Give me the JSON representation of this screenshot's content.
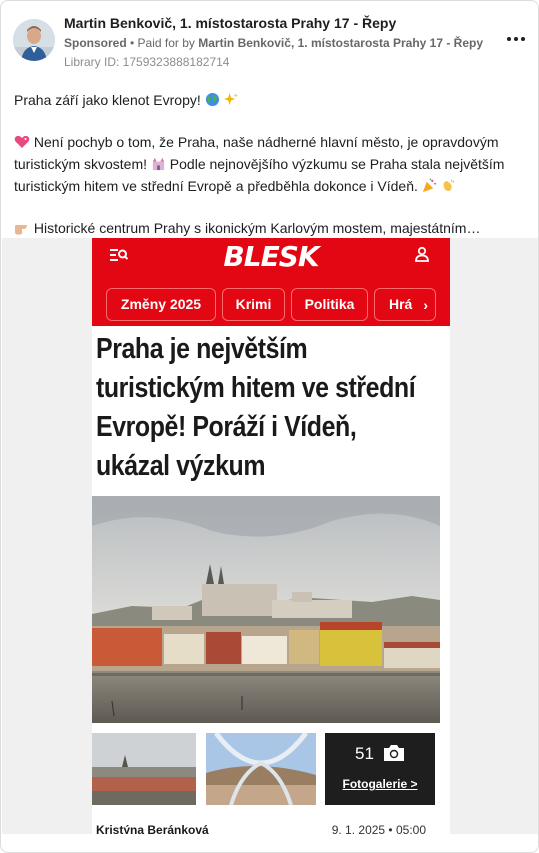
{
  "ad": {
    "advertiser": "Martin Benkovič, 1. místostarosta Prahy 17 - Řepy",
    "sponsored_label": "Sponsored",
    "paid_for_prefix": " • Paid for by ",
    "paid_for_name": "Martin Benkovič, 1. místostarosta Prahy 17 - Řepy",
    "library_id": "Library ID: 1759323888182714",
    "more_icon": "more-horizontal-icon"
  },
  "post": {
    "paragraph1": "Praha září jako klenot Evropy! ",
    "paragraph1_emojis": [
      "globe-icon",
      "sparkles-icon"
    ],
    "paragraph2_a": " Není pochyb o tom, že Praha, naše nádherné hlavní město, je opravdovým turistickým skvostem! ",
    "paragraph2_b": " Podle nejnovějšího výzkumu se Praha stala největším turistickým hitem ve střední Evropě a předběhla dokonce i Vídeň. ",
    "paragraph3": " Historické centrum Prahy s ikonickým Karlovým mostem, majestátním…"
  },
  "article": {
    "logo": "BLESK",
    "nav": [
      "Změny 2025",
      "Krimi",
      "Politika",
      "Hrá"
    ],
    "nav_arrow": "›",
    "headline": "Praha je největším turistickým hitem ve střední Evropě! Poráží i Vídeň, ukázal výzkum",
    "gallery_count": "51",
    "gallery_label": "Fotogalerie >",
    "author": "Kristýna Beránková",
    "date": "9. 1. 2025 • 05:00"
  },
  "colors": {
    "blesk_red": "#e30613",
    "text": "#1c1e21",
    "muted": "#65676b"
  }
}
